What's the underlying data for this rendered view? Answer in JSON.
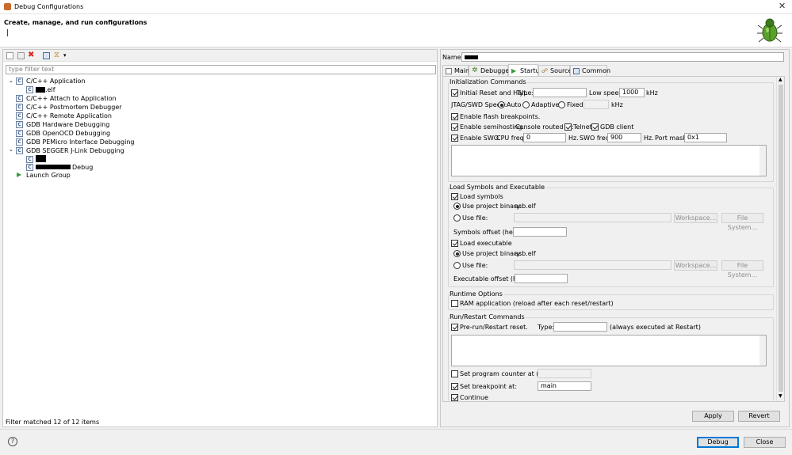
{
  "window": {
    "title": "Debug Configurations"
  },
  "header": {
    "title": "Create, manage, and run configurations",
    "cursor_text": "|"
  },
  "left": {
    "filter_placeholder": "type filter text",
    "tree": [
      {
        "label": "C/C++ Application",
        "expanded": true,
        "children": [
          {
            "label": ".elf",
            "redacted": true
          }
        ]
      },
      {
        "label": "C/C++ Attach to Application"
      },
      {
        "label": "C/C++ Postmortem Debugger"
      },
      {
        "label": "C/C++ Remote Application"
      },
      {
        "label": "GDB Hardware Debugging"
      },
      {
        "label": "GDB OpenOCD Debugging"
      },
      {
        "label": "GDB PEMicro Interface Debugging"
      },
      {
        "label": "GDB SEGGER J-Link Debugging",
        "expanded": true,
        "children": [
          {
            "label": "",
            "redacted": true
          },
          {
            "label": "Debug",
            "redacted": true
          }
        ]
      },
      {
        "label": "Launch Group"
      }
    ],
    "status": "Filter matched 12 of 12 items"
  },
  "right": {
    "name_label": "Name:",
    "tabs": [
      {
        "label": "Main",
        "icon": "main-tab-icon"
      },
      {
        "label": "Debugger",
        "icon": "debugger-tab-icon"
      },
      {
        "label": "Startup",
        "icon": "startup-tab-icon",
        "selected": true
      },
      {
        "label": "Source",
        "icon": "source-tab-icon"
      },
      {
        "label": "Common",
        "icon": "common-tab-icon"
      }
    ],
    "init": {
      "title": "Initialization Commands",
      "initial_reset": "Initial Reset and Halt.",
      "type_label": "Type:",
      "low_speed_label": "Low speed:",
      "low_speed_value": "1000",
      "khz": "kHz",
      "jtag_label": "JTAG/SWD Speed:",
      "auto": "Auto",
      "adaptive": "Adaptive",
      "fixed": "Fixed",
      "enable_flash_bp": "Enable flash breakpoints.",
      "enable_semihosting": "Enable semihosting.",
      "console_routed": "Console routed to:",
      "telnet": "Telnet",
      "gdb_client": "GDB client",
      "enable_swo": "Enable SWO.",
      "cpu_freq_label": "CPU freq:",
      "cpu_freq_value": "0",
      "hz": "Hz.",
      "swo_freq_label": "SWO freq:",
      "swo_freq_value": "900",
      "port_mask_label": "Port mask:",
      "port_mask_value": "0x1"
    },
    "load": {
      "title": "Load Symbols and Executable",
      "load_symbols": "Load symbols",
      "use_project_binary": "Use project binary:",
      "binary_name": "asb.elf",
      "use_file": "Use file:",
      "workspace": "Workspace...",
      "file_system": "File System...",
      "symbols_offset": "Symbols offset (hex):",
      "load_executable": "Load executable",
      "executable_offset": "Executable offset (hex):"
    },
    "runtime": {
      "title": "Runtime Options",
      "ram_app": "RAM application (reload after each reset/restart)"
    },
    "runrestart": {
      "title": "Run/Restart Commands",
      "pre_run": "Pre-run/Restart reset.",
      "type_label": "Type:",
      "always_note": "(always executed at Restart)",
      "set_pc": "Set program counter at (hex):",
      "set_bp": "Set breakpoint at:",
      "bp_value": "main",
      "continue": "Continue"
    },
    "apply": "Apply",
    "revert": "Revert"
  },
  "footer": {
    "debug": "Debug",
    "close": "Close"
  },
  "colors": {
    "accent": "#0078d7",
    "header_bg": "#ffffff",
    "panel_bg": "#f0f0f0"
  }
}
